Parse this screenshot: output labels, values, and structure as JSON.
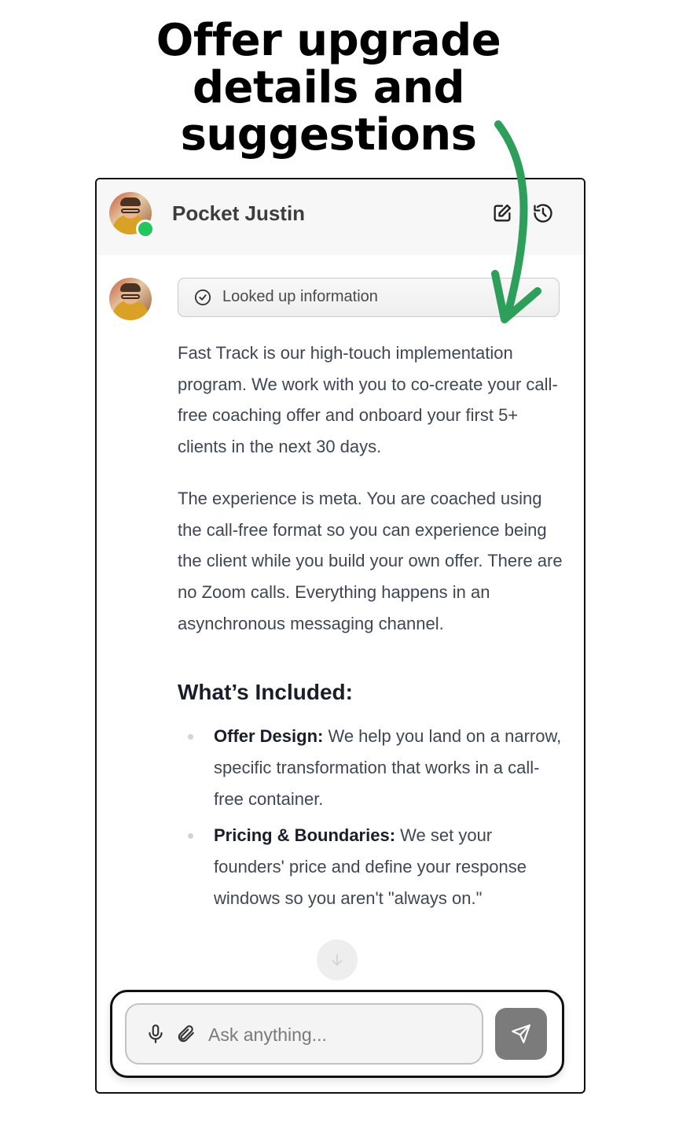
{
  "headline": "Offer upgrade\ndetails and\nsuggestions",
  "header": {
    "title": "Pocket Justin"
  },
  "message": {
    "lookup_label": "Looked up information",
    "paragraph_1": "Fast Track is our high-touch implementation program. We work with you to co-create your call-free coaching offer and onboard your first 5+ clients in the next 30 days.",
    "paragraph_2": "The experience is meta. You are coached using the call-free format so you can experience being the client while you build your own offer. There are no Zoom calls. Everything happens in an asynchronous messaging channel.",
    "section_heading": "What’s Included:",
    "items": [
      {
        "title": "Offer Design:",
        "text": " We help you land on a narrow, specific transformation that works in a call-free container."
      },
      {
        "title": "Pricing & Boundaries:",
        "text": " We set your founders' price and define your response windows so you aren't \"always on.\""
      }
    ]
  },
  "composer": {
    "placeholder": "Ask anything..."
  },
  "colors": {
    "online": "#22c55e",
    "arrow": "#2e9e5b",
    "send_button": "#7b7b7b"
  },
  "icons": [
    "edit-icon",
    "history-icon",
    "check-circle-icon",
    "chevron-down-icon",
    "mic-icon",
    "paperclip-icon",
    "send-icon"
  ]
}
